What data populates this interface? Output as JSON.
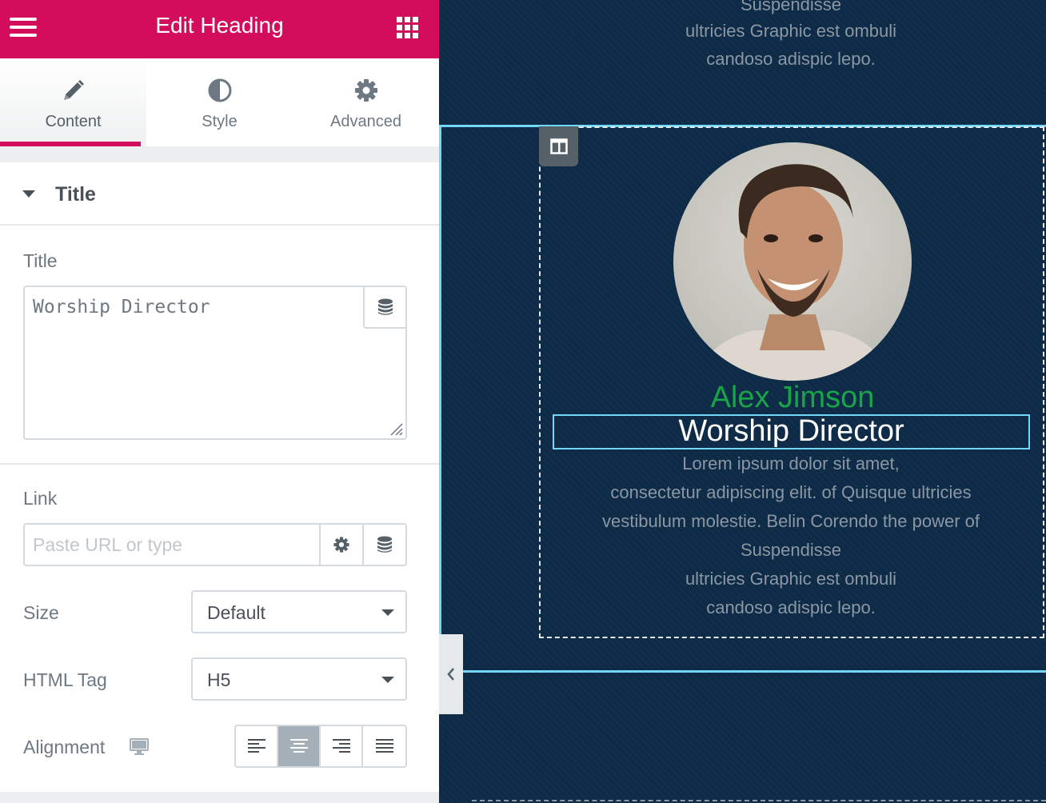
{
  "panel": {
    "title": "Edit Heading",
    "tabs": [
      {
        "label": "Content",
        "icon": "pencil-icon",
        "active": true
      },
      {
        "label": "Style",
        "icon": "half-circle-icon",
        "active": false
      },
      {
        "label": "Advanced",
        "icon": "gear-icon",
        "active": false
      }
    ],
    "section": {
      "title": "Title",
      "title_field": {
        "label": "Title",
        "value": "Worship Director"
      },
      "link_field": {
        "label": "Link",
        "placeholder": "Paste URL or type"
      },
      "size_field": {
        "label": "Size",
        "value": "Default"
      },
      "html_tag_field": {
        "label": "HTML Tag",
        "value": "H5"
      },
      "alignment_field": {
        "label": "Alignment",
        "options": [
          "left",
          "center",
          "right",
          "justify"
        ],
        "active": "center"
      }
    }
  },
  "canvas": {
    "top_text": [
      "Suspendisse",
      "ultricies Graphic est ombuli",
      "candoso adispic lepo."
    ],
    "name": "Alex Jimson",
    "heading": "Worship Director",
    "name_color": "#17a548",
    "body_text": [
      "Lorem ipsum dolor sit amet,",
      "consectetur adipiscing elit. of Quisque ultricies",
      "vestibulum molestie. Belin Corendo  the power of",
      "Suspendisse",
      "ultricies Graphic est ombuli",
      "candoso adispic lepo."
    ]
  },
  "colors": {
    "accent": "#d30c5c",
    "selection": "#71d7f7",
    "background": "#0d2a47"
  }
}
